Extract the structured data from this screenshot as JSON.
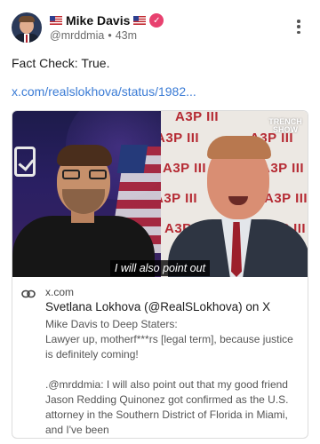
{
  "author": {
    "name": "Mike Davis",
    "handle": "@mrddmia",
    "separator": "•",
    "time": "43m",
    "verified_mark": "✓"
  },
  "post": {
    "text": "Fact Check: True.",
    "link": "x.com/realslokhova/status/1982..."
  },
  "embed": {
    "caption": "I will also point out",
    "domain": "x.com",
    "title": "Svetlana Lokhova (@RealSLokhova) on X",
    "description": [
      "Mike Davis to Deep Staters:\nLawyer up, motherf***rs [legal term], because justice is definitely coming!",
      ".@mrddmia: I will also point out that my good friend Jason Redding Quinonez got confirmed as the U.S. attorney in the Southern District of Florida in Miami, and I've been"
    ],
    "right_panel_brand": "A3P III",
    "watermark": "TRENCH SHOW"
  },
  "icons": {
    "avatar": "profile-photo",
    "flag": "us-flag-icon",
    "verified": "verified-badge-icon",
    "more": "more-vertical-icon",
    "link": "link-icon"
  },
  "colors": {
    "link": "#3a7bd5",
    "verified_badge": "#e8416f",
    "brand_red": "#b52a33"
  }
}
